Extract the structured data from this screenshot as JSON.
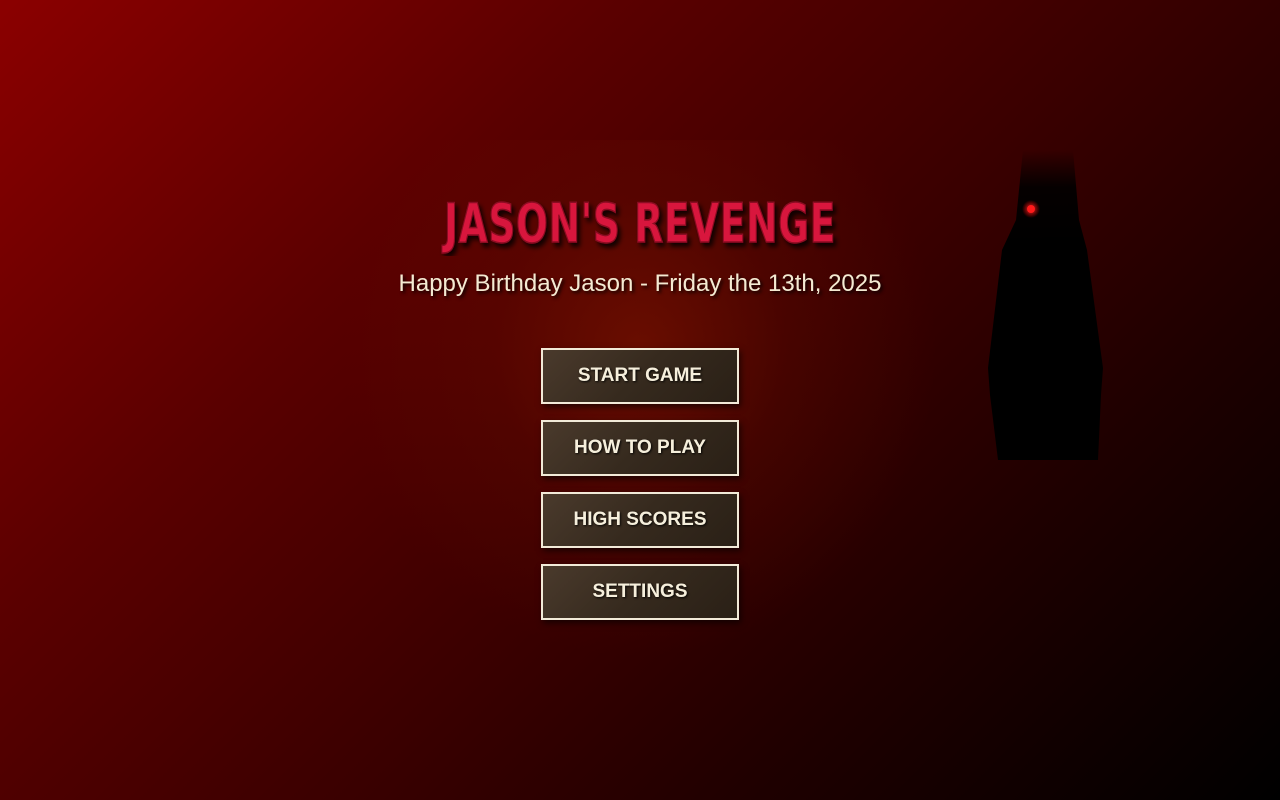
{
  "game": {
    "title": "JASON'S REVENGE",
    "subtitle": "Happy Birthday Jason - Friday the 13th, 2025"
  },
  "menu": {
    "items": [
      {
        "label": "START GAME"
      },
      {
        "label": "HOW TO PLAY"
      },
      {
        "label": "HIGH SCORES"
      },
      {
        "label": "SETTINGS"
      }
    ]
  },
  "colors": {
    "title": "#d8143c",
    "eye": "#ff1a1a",
    "button_border": "#f2ead8",
    "background_top": "#8b0000"
  },
  "icons": {
    "figure": "shadow-figure-icon"
  }
}
